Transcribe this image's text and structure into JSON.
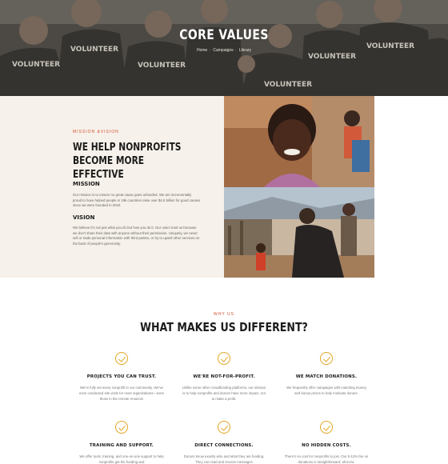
{
  "hero": {
    "title": "CORE VALUES",
    "breadcrumb": [
      "Home",
      "Campaigns",
      "Library"
    ],
    "shirt_text": "VOLUNTEER"
  },
  "mission": {
    "eyebrow": "MISSION &VISION",
    "title_line1": "WE HELP NONPROFITS",
    "title_line2": "BECOME MORE EFFECTIVE",
    "mission_heading": "MISSION",
    "mission_text": "Our mission is to ensure no great cause goes unfunded. We are incrementally proud to have helped people in 19k countries raise over $4.5 billion for good causes since we were founded in 2010.",
    "vision_heading": "VISION",
    "vision_text": "We believe it's not just what you do but how you do it. Our users trust us because we don't share their data with anyone without their permission. Uniquely, we never sell or trade personal information with third parties, or try to upsell other services on the back of people's generosity."
  },
  "different": {
    "eyebrow": "WHY US",
    "title": "WHAT MAKES US DIFFERENT?",
    "features": [
      {
        "title": "PROJECTS YOU CAN TRUST.",
        "text": "We're fully vet every nonprofit in our community. We've even conducted site visits for most organizations—even those in the remote Amazon!"
      },
      {
        "title": "WE'RE NOT-FOR-PROFIT.",
        "text": "Unlike some other crowdfunding platforms, our mission is to help nonprofits and donors have more impact, not to make a profit."
      },
      {
        "title": "WE MATCH DONATIONS.",
        "text": "We frequently offer campaigns with matching money and bonus prizes to help motivate donors."
      },
      {
        "title": "TRAINING AND SUPPORT.",
        "text": "We offer tools, training, and one-on-one support to help nonprofits get the funding and"
      },
      {
        "title": "DIRECT CONNECTIONS.",
        "text": "Donors know exactly who and what they are funding. They can read and receive messages"
      },
      {
        "title": "NO HIDDEN COSTS.",
        "text": "There's no cost for nonprofits to join. Our 5-12% fee on donations is straightforward; all-inclu-"
      }
    ]
  },
  "colors": {
    "accent": "#d1502f",
    "check": "#e1a524",
    "mission_bg": "#f6f1ea"
  }
}
